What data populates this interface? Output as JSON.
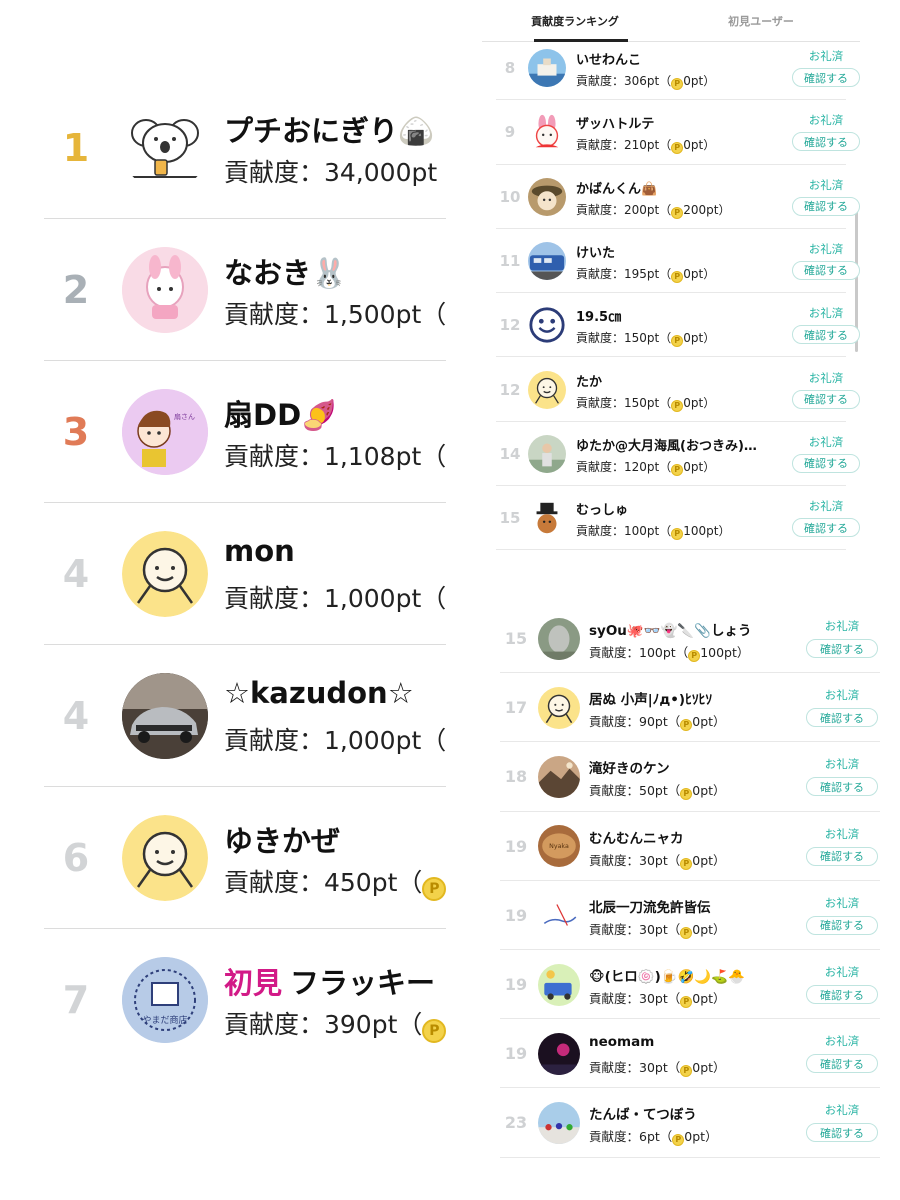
{
  "score_label": "貢献度",
  "left_panel": {
    "rows": [
      {
        "rank": "1",
        "rank_color": "#e6b53a",
        "name": "プチおにぎり🍙",
        "score": "貢献度：34,000pt",
        "first_view": false,
        "avatar": "koala-icon"
      },
      {
        "rank": "2",
        "rank_color": "#a9b0b6",
        "name": "なおき🐰",
        "score": "貢献度：1,500pt（",
        "first_view": false,
        "avatar": "melody-icon"
      },
      {
        "rank": "3",
        "rank_color": "#e07b57",
        "name": "扇DD🍠",
        "score": "貢献度：1,108pt（",
        "first_view": false,
        "avatar": "illustration-icon"
      },
      {
        "rank": "4",
        "rank_color": "#d2d4d6",
        "name": "mon",
        "score": "貢献度：1,000pt（",
        "first_view": false,
        "avatar": "default-face-icon"
      },
      {
        "rank": "4",
        "rank_color": "#d2d4d6",
        "name": "☆kazudon☆",
        "score": "貢献度：1,000pt（",
        "first_view": false,
        "avatar": "car-icon"
      },
      {
        "rank": "6",
        "rank_color": "#d2d4d6",
        "name": "ゆきかぜ",
        "score": "貢献度：450pt（",
        "first_view": false,
        "avatar": "default-face-icon",
        "coin": true
      },
      {
        "rank": "7",
        "rank_color": "#d2d4d6",
        "first_tag": "初見",
        "name": "フラッキー",
        "score": "貢献度：390pt（",
        "first_view": true,
        "avatar": "shop-stamp-icon",
        "coin": true
      }
    ]
  },
  "right_top": {
    "tabs": [
      {
        "label": "貢献度ランキング",
        "active": true
      },
      {
        "label": "初見ユーザー",
        "active": false
      }
    ],
    "rows": [
      {
        "rank": "8",
        "name": "いせわんこ",
        "score_prefix": "貢献度：306pt（",
        "coin_value": "0pt",
        "score_suffix": "）",
        "thanks": "お礼済",
        "confirm": "確認する",
        "avatar": "ship-icon"
      },
      {
        "rank": "9",
        "name": "ザッハトルテ",
        "score_prefix": "貢献度：210pt（",
        "coin_value": "0pt",
        "score_suffix": "）",
        "thanks": "お礼済",
        "confirm": "確認する",
        "avatar": "bunny-icon"
      },
      {
        "rank": "10",
        "name": "かばんくん👜",
        "score_prefix": "貢献度：200pt（",
        "coin_value": "200pt",
        "score_suffix": "）",
        "thanks": "お礼済",
        "confirm": "確認する",
        "avatar": "hat-character-icon"
      },
      {
        "rank": "11",
        "name": "けいた",
        "score_prefix": "貢献度：195pt（",
        "coin_value": "0pt",
        "score_suffix": "）",
        "thanks": "お礼済",
        "confirm": "確認する",
        "avatar": "train-icon"
      },
      {
        "rank": "12",
        "name": "19.5㎝",
        "score_prefix": "貢献度：150pt（",
        "coin_value": "0pt",
        "score_suffix": "）",
        "thanks": "お礼済",
        "confirm": "確認する",
        "avatar": "smiley-icon"
      },
      {
        "rank": "12",
        "name": "たか",
        "score_prefix": "貢献度：150pt（",
        "coin_value": "0pt",
        "score_suffix": "）",
        "thanks": "お礼済",
        "confirm": "確認する",
        "avatar": "default-face-icon"
      },
      {
        "rank": "14",
        "name": "ゆたか@大月海風(おつきみ)…",
        "score_prefix": "貢献度：120pt（",
        "coin_value": "0pt",
        "score_suffix": "）",
        "thanks": "お礼済",
        "confirm": "確認する",
        "avatar": "person-photo-icon"
      },
      {
        "rank": "15",
        "name": "むっしゅ",
        "score_prefix": "貢献度：100pt（",
        "coin_value": "100pt",
        "score_suffix": "）",
        "thanks": "お礼済",
        "confirm": "確認する",
        "avatar": "bear-hat-icon"
      }
    ]
  },
  "right_bottom": {
    "rows": [
      {
        "rank": "15",
        "name": "syOu🐙👓👻🔪📎しょう",
        "score_prefix": "貢献度：100pt（",
        "coin_value": "100pt",
        "score_suffix": "）",
        "thanks": "お礼済",
        "confirm": "確認する",
        "avatar": "statue-icon"
      },
      {
        "rank": "17",
        "name": "居ぬ 小声|ﾉд•)ﾋｿﾋｿ",
        "score_prefix": "貢献度：90pt（",
        "coin_value": "0pt",
        "score_suffix": "）",
        "thanks": "お礼済",
        "confirm": "確認する",
        "avatar": "default-face-icon"
      },
      {
        "rank": "18",
        "name": "滝好きのケン",
        "score_prefix": "貢献度：50pt（",
        "coin_value": "0pt",
        "score_suffix": "）",
        "thanks": "お礼済",
        "confirm": "確認する",
        "avatar": "landscape-icon"
      },
      {
        "rank": "19",
        "name": "むんむんニャカ",
        "score_prefix": "貢献度：30pt（",
        "coin_value": "0pt",
        "score_suffix": "）",
        "thanks": "お礼済",
        "confirm": "確認する",
        "avatar": "bread-icon"
      },
      {
        "rank": "19",
        "name": "北辰一刀流免許皆伝",
        "score_prefix": "貢献度：30pt（",
        "coin_value": "0pt",
        "score_suffix": "）",
        "thanks": "お礼済",
        "confirm": "確認する",
        "avatar": "sketch-icon"
      },
      {
        "rank": "19",
        "name": "🐵(ヒロ🍥)🍺🤣🌙⛳🐣",
        "score_prefix": "貢献度：30pt（",
        "coin_value": "0pt",
        "score_suffix": "）",
        "thanks": "お礼済",
        "confirm": "確認する",
        "avatar": "truck-icon"
      },
      {
        "rank": "19",
        "name": "neomam",
        "score_prefix": "貢献度：30pt（",
        "coin_value": "0pt",
        "score_suffix": "）",
        "thanks": "お礼済",
        "confirm": "確認する",
        "avatar": "night-icon"
      },
      {
        "rank": "23",
        "name": "たんば・てつぼう",
        "score_prefix": "貢献度：6pt（",
        "coin_value": "0pt",
        "score_suffix": "）",
        "thanks": "お礼済",
        "confirm": "確認する",
        "avatar": "crowd-icon"
      }
    ]
  }
}
